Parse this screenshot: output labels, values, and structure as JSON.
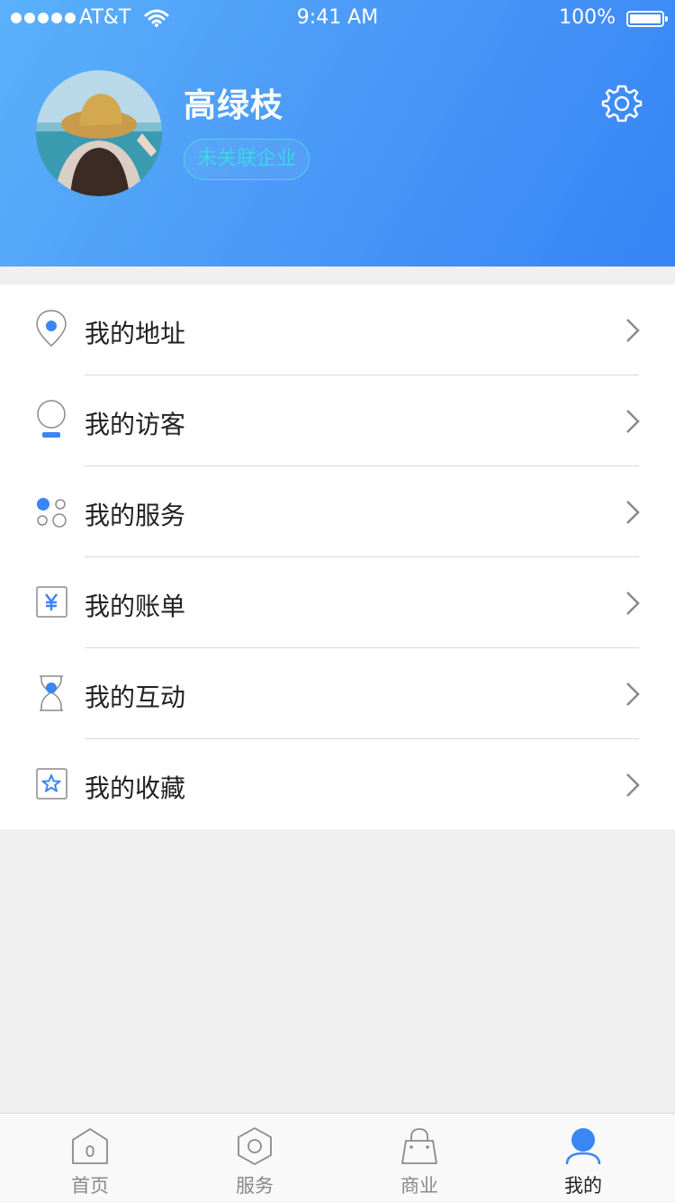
{
  "status_bar": {
    "carrier": "AT&T",
    "time": "9:41 AM",
    "battery": "100%"
  },
  "profile": {
    "name": "高绿枝",
    "company_status": "未关联企业"
  },
  "menu": {
    "items": [
      {
        "label": "我的地址",
        "icon": "location-pin-icon"
      },
      {
        "label": "我的访客",
        "icon": "visitor-icon"
      },
      {
        "label": "我的服务",
        "icon": "service-dots-icon"
      },
      {
        "label": "我的账单",
        "icon": "yen-bill-icon"
      },
      {
        "label": "我的互动",
        "icon": "hourglass-icon"
      },
      {
        "label": "我的收藏",
        "icon": "star-icon"
      }
    ]
  },
  "tabbar": {
    "items": [
      {
        "label": "首页",
        "icon": "home-icon"
      },
      {
        "label": "服务",
        "icon": "hexagon-icon"
      },
      {
        "label": "商业",
        "icon": "shopping-bag-icon"
      },
      {
        "label": "我的",
        "icon": "user-icon",
        "active": true
      }
    ]
  },
  "colors": {
    "accent": "#3a86f5",
    "badge": "#3ad7e4",
    "icon_gray": "#8a8a8a"
  }
}
